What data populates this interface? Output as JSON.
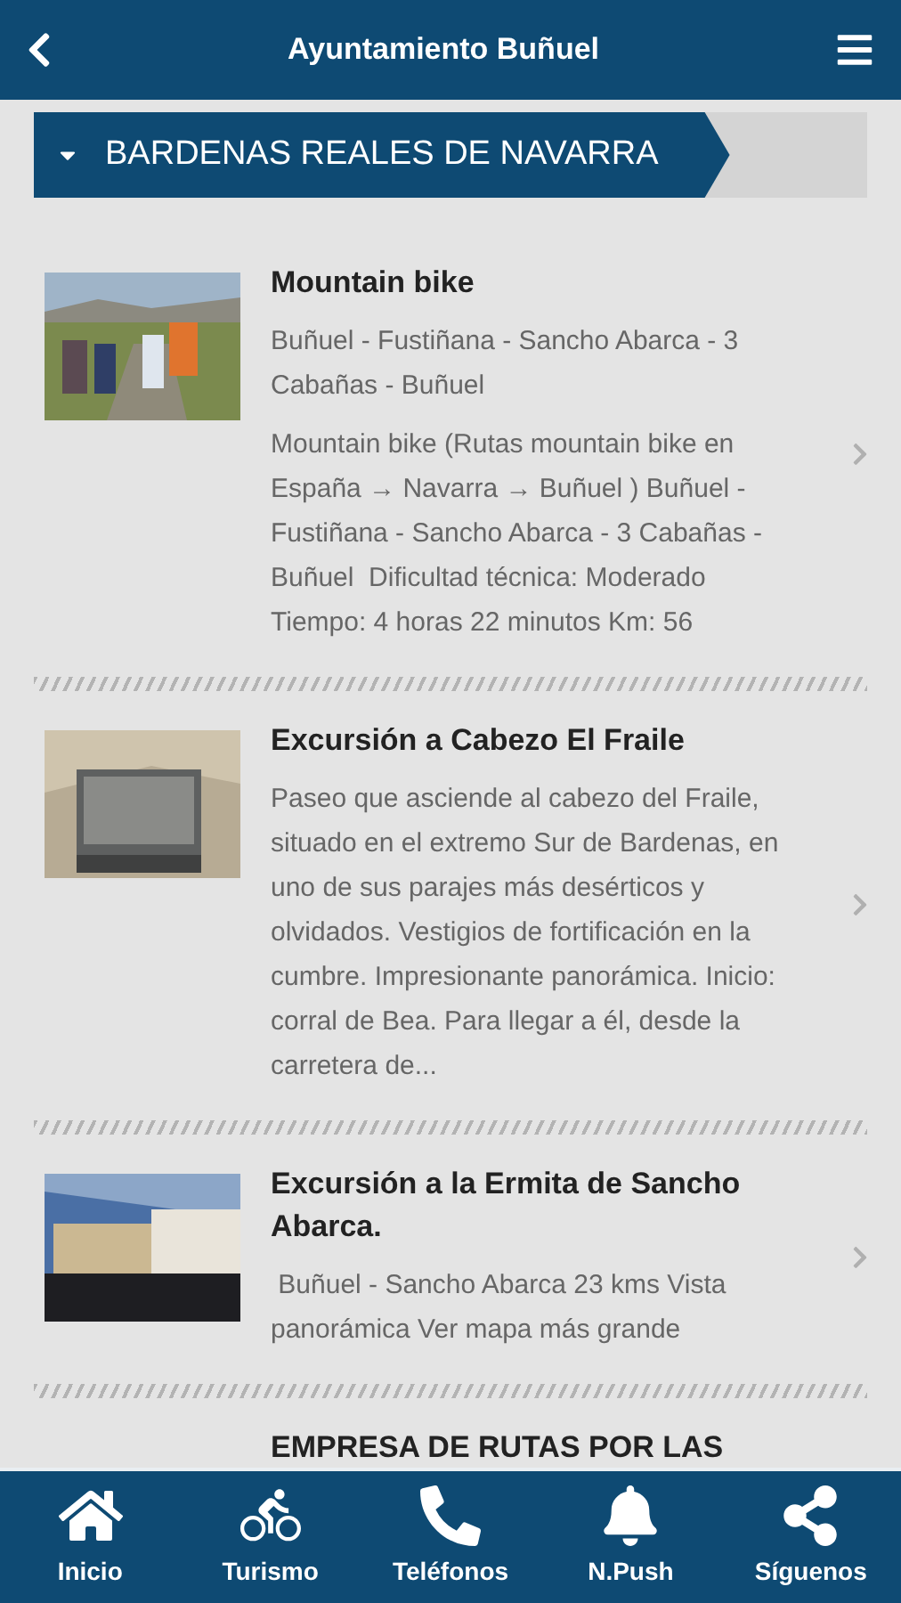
{
  "header": {
    "title": "Ayuntamiento Buñuel"
  },
  "section": {
    "title": "BARDENAS REALES DE NAVARRA",
    "expanded": true
  },
  "items": [
    {
      "title": "Mountain bike",
      "paragraphs": [
        "Buñuel - Fustiñana - Sancho Abarca - 3 Cabañas - Buñuel",
        "Mountain bike (Rutas mountain bike en España → Navarra → Buñuel ) Buñuel - Fustiñana - Sancho Abarca - 3 Cabañas - Buñuel  Dificultad técnica: Moderado Tiempo: 4 horas 22 minutos Km: 56"
      ],
      "kind": "picture"
    },
    {
      "title": "Excursión a Cabezo El Fraile",
      "paragraphs": [
        "Paseo que asciende al cabezo del Fraile, situado en el extremo Sur de Bardenas, en uno de sus parajes más desérticos y olvidados. Vestigios de fortificación en la cumbre. Impresionante panorámica. Inicio: corral de Bea. Para llegar a él, desde la carretera de..."
      ],
      "kind": "picture"
    },
    {
      "title": "Excursión a la Ermita de Sancho Abarca.",
      "paragraphs": [
        " Buñuel - Sancho Abarca 23 kms Vista panorámica Ver mapa más grande"
      ],
      "kind": "picture"
    },
    {
      "title": "EMPRESA DE RUTAS POR LAS"
    }
  ],
  "nav": [
    {
      "label": "Inicio",
      "kind": "home"
    },
    {
      "label": "Turismo",
      "kind": "bike"
    },
    {
      "label": "Teléfonos",
      "kind": "phone"
    },
    {
      "label": "N.Push",
      "kind": "bell"
    },
    {
      "label": "Síguenos",
      "kind": "share"
    }
  ]
}
